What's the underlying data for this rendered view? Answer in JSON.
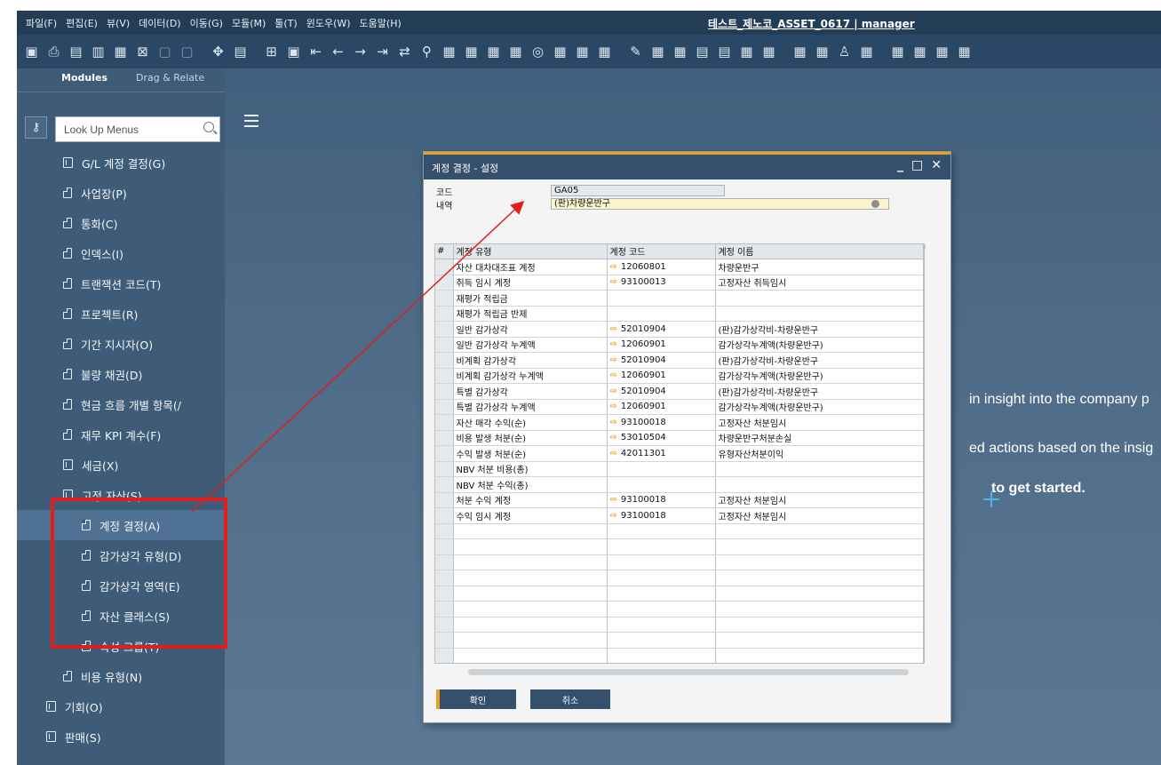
{
  "menubar": {
    "items": [
      "파일(F)",
      "편집(E)",
      "뷰(V)",
      "데이터(D)",
      "이동(G)",
      "모듈(M)",
      "툴(T)",
      "윈도우(W)",
      "도움말(H)"
    ],
    "window_title": "테스트_제노코_ASSET_0617 | manager"
  },
  "sidebar": {
    "tabs": {
      "modules": "Modules",
      "drag_relate": "Drag & Relate"
    },
    "search_placeholder": "Look Up Menus",
    "items": [
      {
        "label": "G/L 계정 결정(G)",
        "icon": "folder-icon"
      },
      {
        "label": "사업장(P)",
        "icon": "doc-icon"
      },
      {
        "label": "통화(C)",
        "icon": "doc-icon"
      },
      {
        "label": "인덱스(I)",
        "icon": "doc-icon"
      },
      {
        "label": "트랜잭션 코드(T)",
        "icon": "doc-icon"
      },
      {
        "label": "프로젝트(R)",
        "icon": "doc-icon"
      },
      {
        "label": "기간 지시자(O)",
        "icon": "doc-icon"
      },
      {
        "label": "불량 채권(D)",
        "icon": "doc-icon"
      },
      {
        "label": "현금 흐름 개별 항목(/",
        "icon": "doc-icon"
      },
      {
        "label": "재무 KPI 계수(F)",
        "icon": "doc-icon"
      },
      {
        "label": "세금(X)",
        "icon": "folder-icon"
      },
      {
        "label": "고정 자산(S)",
        "icon": "folder-icon"
      },
      {
        "label": "계정 결정(A)",
        "icon": "doc-icon",
        "selected": true
      },
      {
        "label": "감가상각 유형(D)",
        "icon": "doc-icon"
      },
      {
        "label": "감가상각 영역(E)",
        "icon": "doc-icon"
      },
      {
        "label": "자산 클래스(S)",
        "icon": "doc-icon"
      },
      {
        "label": "속성 그룹(T)",
        "icon": "doc-icon"
      },
      {
        "label": "비용 유형(N)",
        "icon": "doc-icon"
      },
      {
        "label": "기회(O)",
        "icon": "folder-icon"
      },
      {
        "label": "판매(S)",
        "icon": "folder-icon"
      }
    ]
  },
  "main": {
    "insight_lines": [
      "in insight into the company p",
      "ed actions based on the insig",
      "to get started."
    ]
  },
  "dialog": {
    "title": "계정 결정 - 설정",
    "code_label": "코드",
    "code_value": "GA05",
    "desc_label": "내역",
    "desc_value": "(판)차량운반구",
    "columns": [
      "#",
      "계정 유형",
      "계정 코드",
      "계정 이름"
    ],
    "rows": [
      {
        "type": "자산 대차대조표 계정",
        "code": "12060801",
        "name": "차량운반구"
      },
      {
        "type": "취득 임시 계정",
        "code": "93100013",
        "name": "고정자산 취득임시"
      },
      {
        "type": "재평가 적립금",
        "code": "",
        "name": ""
      },
      {
        "type": "재평가 적립금 반제",
        "code": "",
        "name": ""
      },
      {
        "type": "일반 감가상각",
        "code": "52010904",
        "name": "(판)감가상각비-차량운반구"
      },
      {
        "type": "일반 감가상각 누계액",
        "code": "12060901",
        "name": "감가상각누계액(차량운반구)"
      },
      {
        "type": "비계획 감가상각",
        "code": "52010904",
        "name": "(판)감가상각비-차량운반구"
      },
      {
        "type": "비계획 감가상각 누계액",
        "code": "12060901",
        "name": "감가상각누계액(차량운반구)"
      },
      {
        "type": "특별 감가상각",
        "code": "52010904",
        "name": "(판)감가상각비-차량운반구"
      },
      {
        "type": "특별 감가상각 누계액",
        "code": "12060901",
        "name": "감가상각누계액(차량운반구)"
      },
      {
        "type": "자산 매각 수익(순)",
        "code": "93100018",
        "name": "고정자산 처분임시"
      },
      {
        "type": "비용 발생 처분(순)",
        "code": "53010504",
        "name": "차량운반구처분손실"
      },
      {
        "type": "수익 발생 처분(순)",
        "code": "42011301",
        "name": "유형자산처분이익"
      },
      {
        "type": "NBV 처분 비용(총)",
        "code": "",
        "name": ""
      },
      {
        "type": "NBV 처분 수익(총)",
        "code": "",
        "name": ""
      },
      {
        "type": "처분 수익 계정",
        "code": "93100018",
        "name": "고정자산 처분임시"
      },
      {
        "type": "수익 임시 계정",
        "code": "93100018",
        "name": "고정자산 처분임시"
      }
    ],
    "empty_rows": 9,
    "ok_label": "확인",
    "cancel_label": "취소"
  },
  "colors": {
    "accent": "#e8a21d",
    "annotation": "#e11d1d",
    "header": "#34506d"
  }
}
